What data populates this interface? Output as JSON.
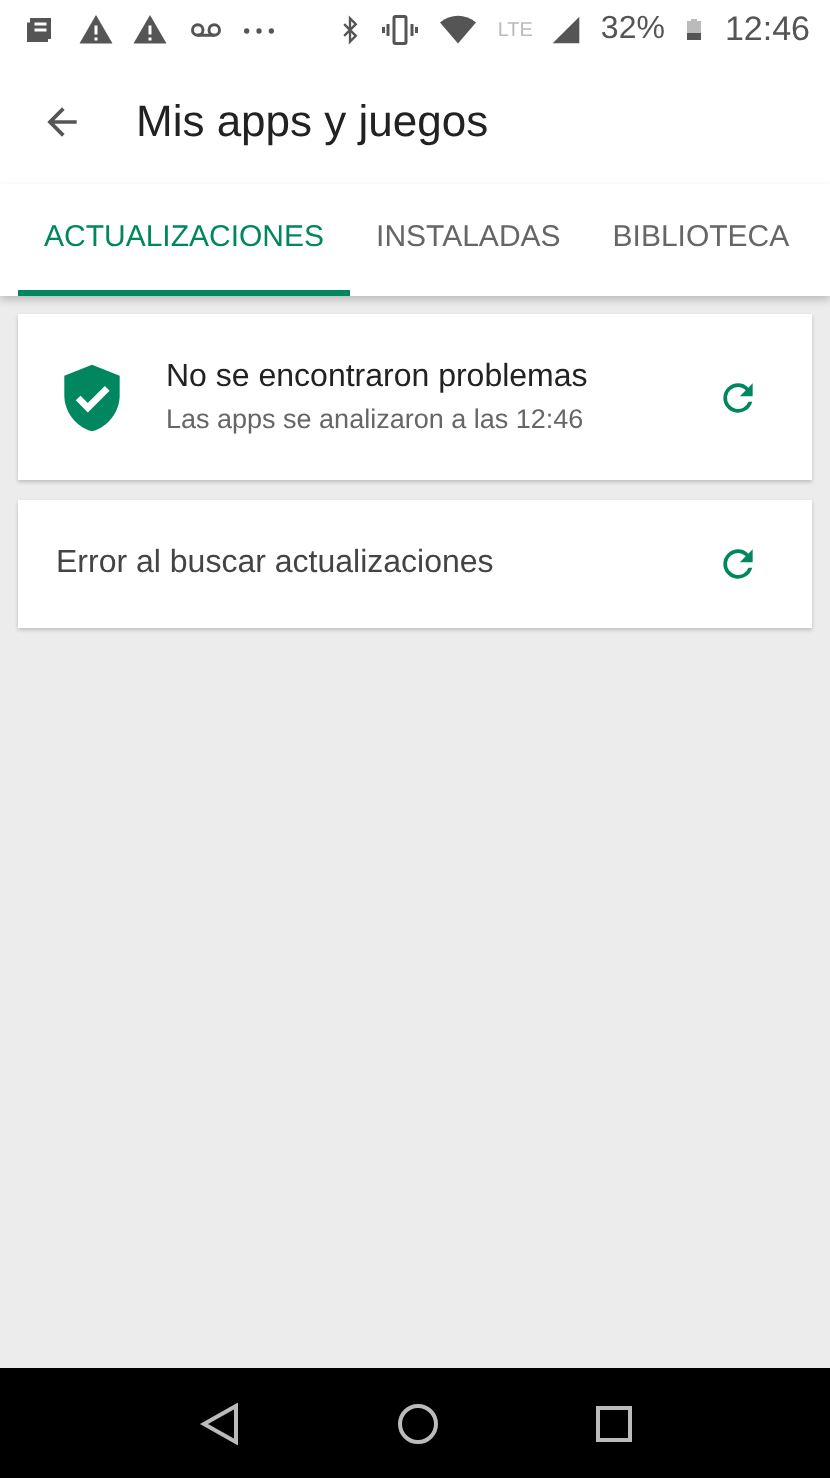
{
  "status_bar": {
    "network": "LTE",
    "battery": "32%",
    "time": "12:46"
  },
  "header": {
    "title": "Mis apps y juegos"
  },
  "tabs": [
    {
      "label": "ACTUALIZACIONES",
      "selected": true
    },
    {
      "label": "INSTALADAS",
      "selected": false
    },
    {
      "label": "BIBLIOTECA",
      "selected": false
    }
  ],
  "cards": [
    {
      "kind": "scan",
      "title": "No se encontraron problemas",
      "subtitle": "Las apps se analizaron a las 12:46"
    },
    {
      "kind": "error",
      "title": "Error al buscar actualizaciones"
    }
  ]
}
